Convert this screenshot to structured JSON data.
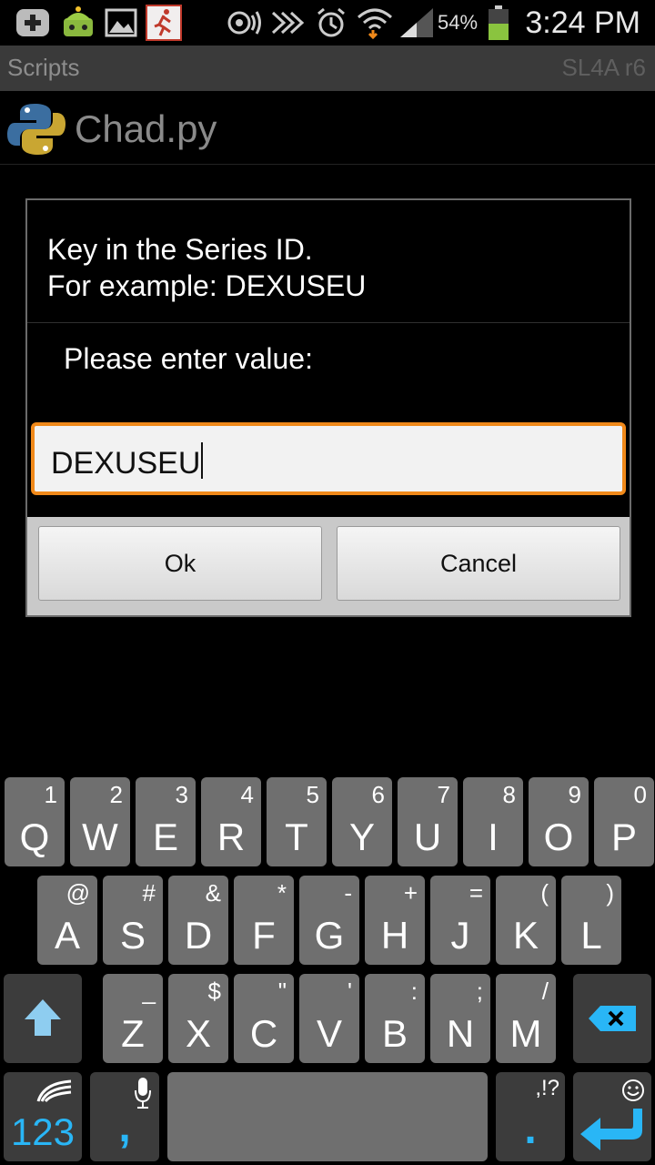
{
  "status_bar": {
    "time": "3:24 PM",
    "battery_percent": "54%",
    "battery_level": 0.54,
    "icons": [
      "add-icon",
      "android-icon",
      "image-icon",
      "runner-icon",
      "location-icon",
      "nfc-icon",
      "mute-icon",
      "alarm-icon",
      "wifi-icon",
      "signal-icon",
      "battery-icon"
    ]
  },
  "title_bar": {
    "title": "Scripts",
    "version": "SL4A r6"
  },
  "script_item": {
    "name": "Chad.py"
  },
  "dialog": {
    "message": "Key in the Series ID.\nFor example: DEXUSEU",
    "prompt": "Please enter value:",
    "input_value": "DEXUSEU",
    "ok_label": "Ok",
    "cancel_label": "Cancel"
  },
  "keyboard": {
    "row1": [
      {
        "main": "Q",
        "sub": "1"
      },
      {
        "main": "W",
        "sub": "2"
      },
      {
        "main": "E",
        "sub": "3"
      },
      {
        "main": "R",
        "sub": "4"
      },
      {
        "main": "T",
        "sub": "5"
      },
      {
        "main": "Y",
        "sub": "6"
      },
      {
        "main": "U",
        "sub": "7"
      },
      {
        "main": "I",
        "sub": "8"
      },
      {
        "main": "O",
        "sub": "9"
      },
      {
        "main": "P",
        "sub": "0"
      }
    ],
    "row2": [
      {
        "main": "A",
        "sub": "@"
      },
      {
        "main": "S",
        "sub": "#"
      },
      {
        "main": "D",
        "sub": "&"
      },
      {
        "main": "F",
        "sub": "*"
      },
      {
        "main": "G",
        "sub": "-"
      },
      {
        "main": "H",
        "sub": "+"
      },
      {
        "main": "J",
        "sub": "="
      },
      {
        "main": "K",
        "sub": "("
      },
      {
        "main": "L",
        "sub": ")"
      }
    ],
    "row3": [
      {
        "main": "Z",
        "sub": "_"
      },
      {
        "main": "X",
        "sub": "$"
      },
      {
        "main": "C",
        "sub": "\""
      },
      {
        "main": "V",
        "sub": "'"
      },
      {
        "main": "B",
        "sub": ":"
      },
      {
        "main": "N",
        "sub": ";"
      },
      {
        "main": "M",
        "sub": "/"
      }
    ],
    "num_label": "123",
    "comma_label": ",",
    "period_label": ".",
    "period_sub": ",!?"
  },
  "colors": {
    "accent_orange": "#f0891a",
    "key_gray": "#6f6f6f",
    "swiftkey_blue": "#29b6f6"
  }
}
